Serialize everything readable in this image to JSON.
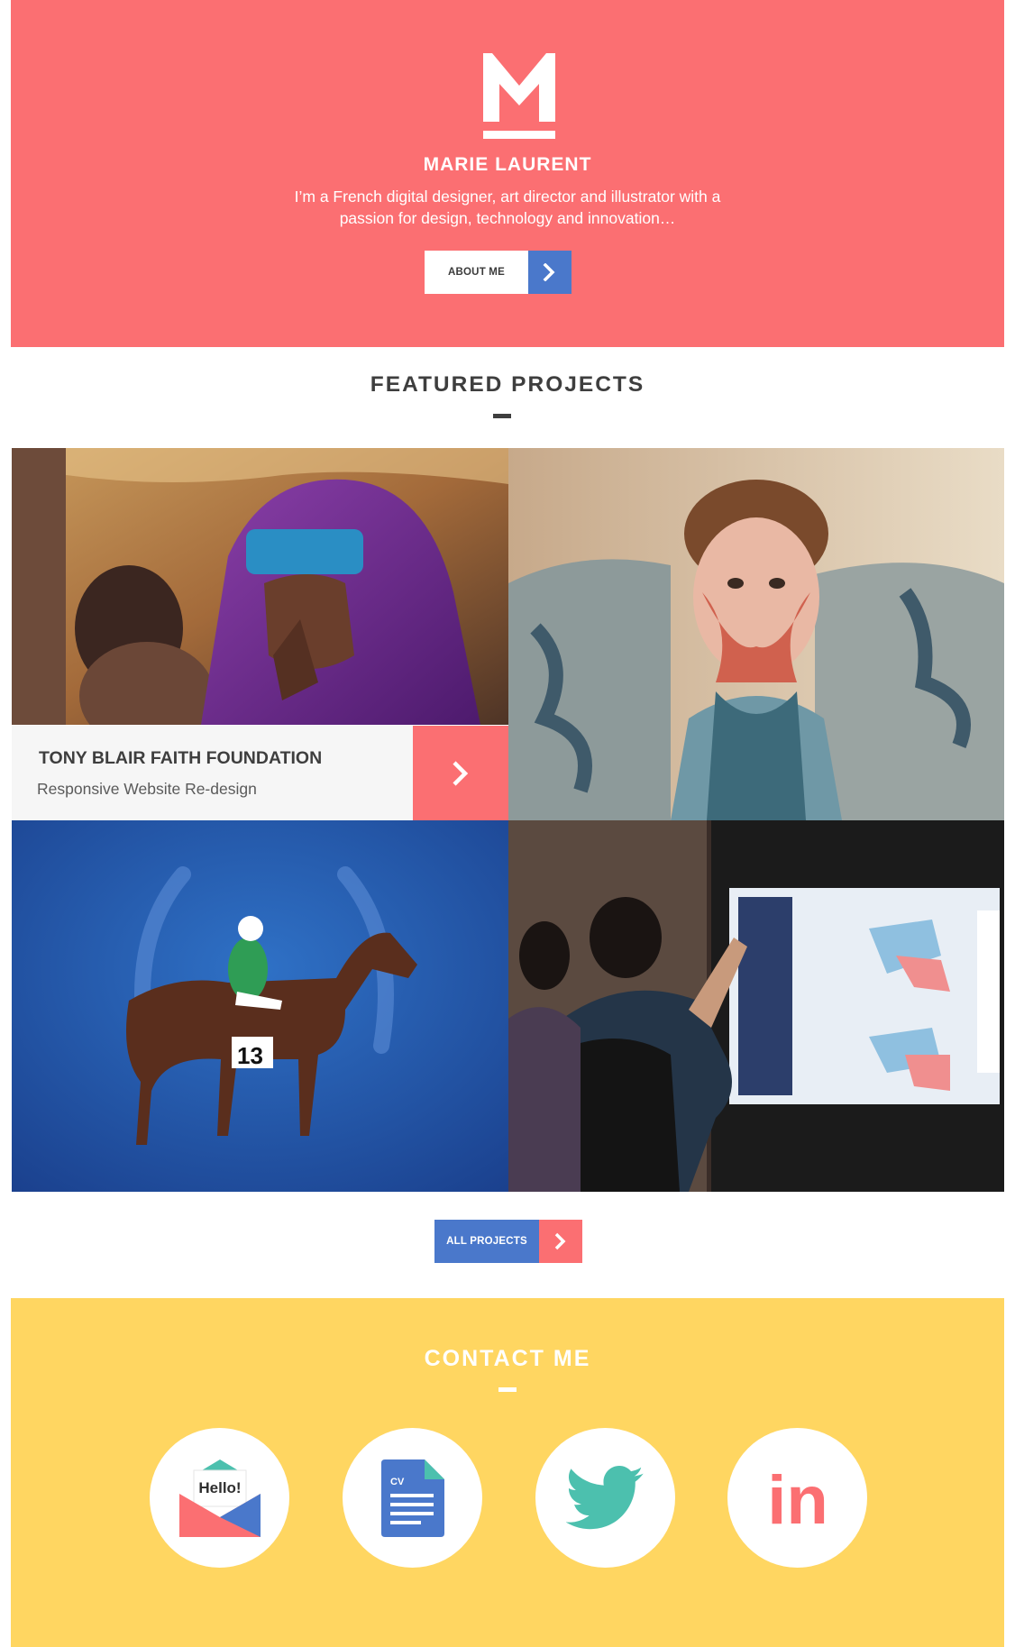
{
  "colors": {
    "coral": "#fb6f72",
    "blue": "#4a78cb",
    "yellow": "#ffd661",
    "teal": "#4cc0ae",
    "dark_text": "#3e3e3e"
  },
  "hero": {
    "logo_letter": "M",
    "name": "MARIE LAURENT",
    "bio_line1": "I’m a French digital designer, art director and illustrator with a",
    "bio_line2": "passion for design, technology and innovation…",
    "about_button": "ABOUT ME",
    "about_arrow_icon": "chevron-right-icon"
  },
  "featured": {
    "title": "FEATURED PROJECTS",
    "projects": [
      {
        "title": "TONY BLAIR FAITH FOUNDATION",
        "subtitle": "Responsive Website Re-design",
        "image": "woman-purple-headscarf-photo",
        "arrow_icon": "chevron-right-icon"
      },
      {
        "image": "body-paint-portrait-photo"
      },
      {
        "image": "jockey-horse-number-13-illustration",
        "badge": "13"
      },
      {
        "image": "touchscreen-kiosk-photo"
      }
    ],
    "all_projects_button": "ALL PROJECTS"
  },
  "contact": {
    "title": "CONTACT ME",
    "items": [
      {
        "name": "email",
        "icon": "hello-envelope-icon",
        "text": "Hello!"
      },
      {
        "name": "cv",
        "icon": "cv-document-icon",
        "text": "CV"
      },
      {
        "name": "twitter",
        "icon": "twitter-bird-icon"
      },
      {
        "name": "linkedin",
        "icon": "linkedin-icon",
        "text": "in"
      }
    ]
  }
}
